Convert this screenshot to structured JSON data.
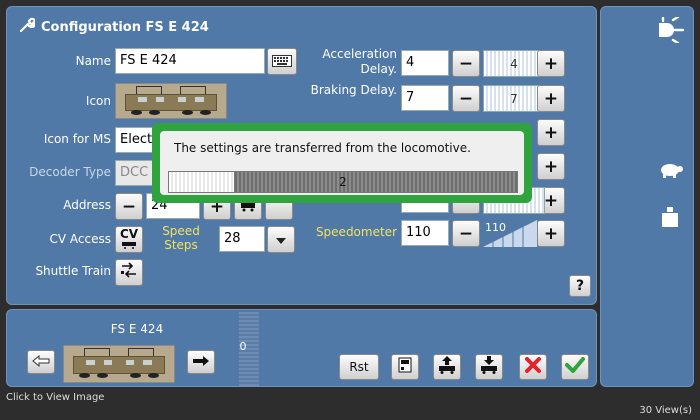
{
  "window_title": "Configuration FS E 424",
  "fields": {
    "name_label": "Name",
    "name_value": "FS E 424",
    "icon_label": "Icon",
    "icon_ms_label": "Icon for MS",
    "icon_ms_value": "Elect",
    "decoder_label": "Decoder Type",
    "decoder_value": "DCC",
    "address_label": "Address",
    "address_value": "24",
    "cv_label": "CV Access",
    "cv_button": "CV",
    "speed_steps_label": "Speed\nSteps",
    "speed_steps_value": "28",
    "shuttle_label": "Shuttle Train"
  },
  "right_fields": {
    "accel_label": "Acceleration\nDelay.",
    "accel_value": "4",
    "accel_slider": "4",
    "braking_label": "Braking Delay.",
    "braking_value": "7",
    "braking_slider": "7",
    "speedometer_label": "Speedometer",
    "speedometer_value": "110",
    "speedometer_slider": "110"
  },
  "dialog": {
    "message": "The settings are transferred from the locomotive.",
    "progress_label": "2",
    "progress_fraction": 0.19
  },
  "bottom": {
    "loco_name": "FS E 424",
    "counter": "0",
    "rst_button": "Rst"
  },
  "help_button": "?",
  "footer": {
    "left": "Click to View Image",
    "right": "30 View(s)"
  },
  "colors": {
    "panel": "#5179a8",
    "dialog_border": "#2fa33e",
    "accent_yellow": "#f2e35a",
    "cancel_red": "#e0242a",
    "confirm_green": "#2fa33e"
  }
}
